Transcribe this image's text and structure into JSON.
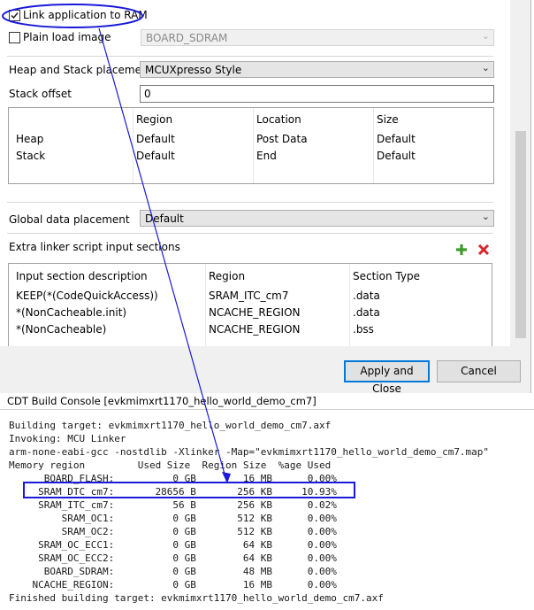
{
  "dialog": {
    "link_to_ram": {
      "label": "Link application to RAM",
      "checked": true
    },
    "plain_load": {
      "label": "Plain load image",
      "checked": false,
      "value": "BOARD_SDRAM"
    },
    "heap_stack_placement": {
      "label": "Heap and Stack placement",
      "value": "MCUXpresso Style"
    },
    "stack_offset": {
      "label": "Stack offset",
      "value": "0"
    },
    "heap_stack_table": {
      "headers": [
        "Region",
        "Location",
        "Size"
      ],
      "rows": [
        {
          "name": "Heap",
          "region": "Default",
          "location": "Post Data",
          "size": "Default"
        },
        {
          "name": "Stack",
          "region": "Default",
          "location": "End",
          "size": "Default"
        }
      ]
    },
    "global_data": {
      "label": "Global data placement",
      "value": "Default"
    },
    "extra_linker": {
      "label": "Extra linker script input sections",
      "add_icon": "plus-icon",
      "remove_icon": "x-icon",
      "headers": [
        "Input section description",
        "Region",
        "Section Type"
      ],
      "rows": [
        {
          "desc": "KEEP(*(CodeQuickAccess))",
          "region": "SRAM_ITC_cm7",
          "type": ".data"
        },
        {
          "desc": "*(NonCacheable.init)",
          "region": "NCACHE_REGION",
          "type": ".data"
        },
        {
          "desc": "*(NonCacheable)",
          "region": "NCACHE_REGION",
          "type": ".bss"
        }
      ]
    },
    "buttons": {
      "apply": "Apply and Close",
      "cancel": "Cancel"
    }
  },
  "console": {
    "title": "CDT Build Console [evkmimxrt1170_hello_world_demo_cm7]",
    "lines": [
      "Building target: evkmimxrt1170_hello_world_demo_cm7.axf",
      "Invoking: MCU Linker",
      "arm-none-eabi-gcc -nostdlib -Xlinker -Map=\"evkmimxrt1170_hello_world_demo_cm7.map\"",
      "Memory region         Used Size  Region Size  %age Used",
      "      BOARD_FLASH:          0 GB        16 MB      0.00%",
      "     SRAM_DTC_cm7:       28656 B       256 KB     10.93%",
      "     SRAM_ITC_cm7:          56 B       256 KB      0.02%",
      "         SRAM_OC1:          0 GB       512 KB      0.00%",
      "         SRAM_OC2:          0 GB       512 KB      0.00%",
      "     SRAM_OC_ECC1:          0 GB        64 KB      0.00%",
      "     SRAM_OC_ECC2:          0 GB        64 KB      0.00%",
      "      BOARD_SDRAM:          0 GB        48 MB      0.00%",
      "    NCACHE_REGION:          0 GB        16 MB      0.00%",
      "Finished building target: evkmimxrt1170_hello_world_demo_cm7.axf"
    ]
  },
  "colors": {
    "annotation": "#1a1ad8",
    "accent": "#0078d7",
    "add": "#3c9a2a",
    "remove": "#d9262b"
  }
}
